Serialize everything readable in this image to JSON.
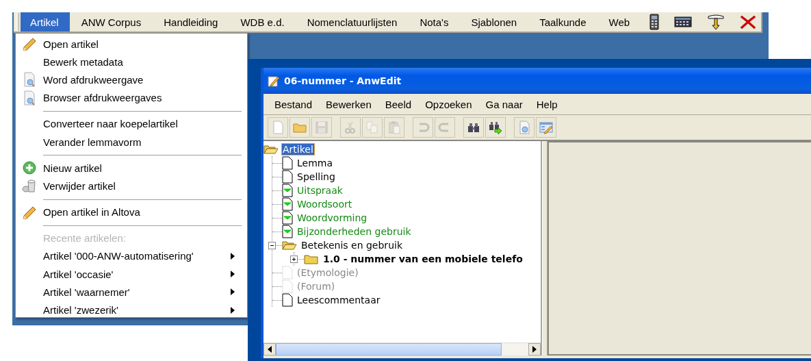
{
  "app_menu_bar": {
    "items": [
      {
        "label": "Artikel",
        "selected": true
      },
      {
        "label": "ANW Corpus",
        "selected": false
      },
      {
        "label": "Handleiding",
        "selected": false
      },
      {
        "label": "WDB e.d.",
        "selected": false
      },
      {
        "label": "Nomenclatuurlijsten",
        "selected": false
      },
      {
        "label": "Nota's",
        "selected": false
      },
      {
        "label": "Sjablonen",
        "selected": false
      },
      {
        "label": "Taalkunde",
        "selected": false
      },
      {
        "label": "Web",
        "selected": false
      }
    ]
  },
  "dropdown_menu": {
    "items": [
      {
        "kind": "item",
        "label": "Open artikel"
      },
      {
        "kind": "item",
        "label": "Bewerk metadata"
      },
      {
        "kind": "item",
        "label": "Word afdrukweergave"
      },
      {
        "kind": "item",
        "label": "Browser afdrukweergaves"
      },
      {
        "kind": "separator"
      },
      {
        "kind": "item",
        "label": "Converteer naar koepelartikel"
      },
      {
        "kind": "item",
        "label": "Verander lemmavorm"
      },
      {
        "kind": "separator"
      },
      {
        "kind": "item",
        "label": "Nieuw artikel"
      },
      {
        "kind": "item",
        "label": "Verwijder artikel"
      },
      {
        "kind": "separator"
      },
      {
        "kind": "item",
        "label": "Open artikel in Altova"
      },
      {
        "kind": "separator"
      },
      {
        "kind": "header",
        "label": "Recente artikelen:"
      },
      {
        "kind": "submenu",
        "label": "Artikel '000-ANW-automatisering'"
      },
      {
        "kind": "submenu",
        "label": "Artikel 'occasie'"
      },
      {
        "kind": "submenu",
        "label": "Artikel 'waarnemer'"
      },
      {
        "kind": "submenu",
        "label": "Artikel 'zwezerik'"
      }
    ]
  },
  "window": {
    "title": "06-nummer - AnwEdit",
    "menu_bar": [
      "Bestand",
      "Bewerken",
      "Beeld",
      "Opzoeken",
      "Ga naar",
      "Help"
    ],
    "toolbar": [
      [
        {
          "disabled": false
        },
        {
          "disabled": false
        },
        {
          "disabled": true
        }
      ],
      [
        {
          "disabled": true
        },
        {
          "disabled": true
        },
        {
          "disabled": true
        }
      ],
      [
        {
          "disabled": true
        },
        {
          "disabled": true
        }
      ],
      [
        {
          "disabled": false
        },
        {
          "disabled": false
        }
      ],
      [
        {
          "disabled": false
        },
        {
          "disabled": false
        }
      ]
    ],
    "tree": {
      "kind": "folder",
      "label": "Artikel",
      "selected": true,
      "children": [
        {
          "kind": "section",
          "label": "Lemma",
          "selected": false
        },
        {
          "kind": "section",
          "label": "Spelling",
          "selected": false
        },
        {
          "kind": "filled",
          "label": "Uitspraak",
          "selected": false
        },
        {
          "kind": "filled",
          "label": "Woordsoort",
          "selected": false
        },
        {
          "kind": "filled",
          "label": "Woordvorming",
          "selected": false
        },
        {
          "kind": "filled",
          "label": "Bijzonderheden gebruik",
          "selected": false
        },
        {
          "kind": "folder",
          "label": "Betekenis en gebruik",
          "selected": false,
          "expanded": true,
          "children": [
            {
              "kind": "sense",
              "label": "1.0 - nummer van een mobiele telefo",
              "selected": false,
              "expanded": false
            }
          ]
        },
        {
          "kind": "empty",
          "label": "(Etymologie)",
          "selected": false
        },
        {
          "kind": "empty",
          "label": "(Forum)",
          "selected": false
        },
        {
          "kind": "section",
          "label": "Leescommentaar",
          "selected": false
        }
      ]
    }
  }
}
